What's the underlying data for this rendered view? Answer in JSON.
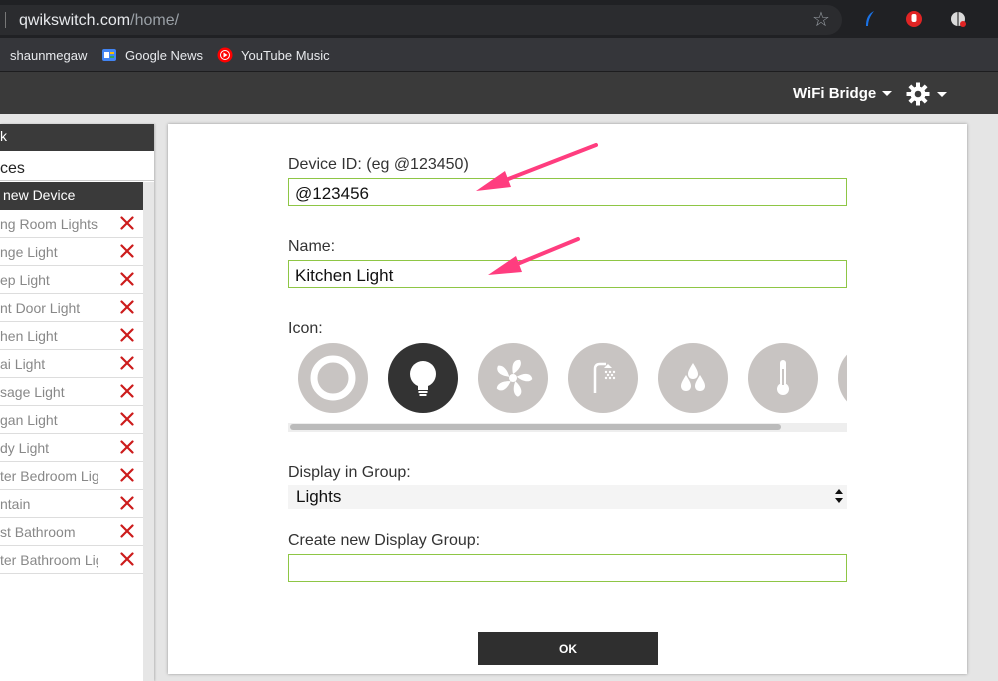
{
  "browser": {
    "url_host": "qwikswitch.com",
    "url_path": "/home/",
    "bookmarks": [
      {
        "label": "shaunmegaw"
      },
      {
        "label": "Google News"
      },
      {
        "label": "YouTube Music"
      }
    ]
  },
  "header": {
    "bridge_label": "WiFi Bridge"
  },
  "sidebar": {
    "top_label": "k",
    "tab_label": "ces",
    "new_device_label": "new Device",
    "items": [
      {
        "label": "ng Room Lights"
      },
      {
        "label": "nge Light"
      },
      {
        "label": "ep Light"
      },
      {
        "label": "nt Door Light"
      },
      {
        "label": "hen Light"
      },
      {
        "label": "ai Light"
      },
      {
        "label": "sage Light"
      },
      {
        "label": "gan Light"
      },
      {
        "label": "dy Light"
      },
      {
        "label": "ter Bedroom Ligl"
      },
      {
        "label": "ntain"
      },
      {
        "label": "st Bathroom"
      },
      {
        "label": "ter Bathroom Lig"
      }
    ]
  },
  "form": {
    "device_id_label": "Device ID: (eg @123450)",
    "device_id_value": "@123456",
    "name_label": "Name:",
    "name_value": "Kitchen Light",
    "icon_label": "Icon:",
    "icons": [
      "ring-icon",
      "lightbulb-icon",
      "fan-icon",
      "shower-icon",
      "water-drops-icon",
      "thermometer-icon",
      "partial-icon"
    ],
    "selected_icon": "lightbulb-icon",
    "group_label": "Display in Group:",
    "group_value": "Lights",
    "new_group_label": "Create new Display Group:",
    "new_group_value": "",
    "ok_label": "OK"
  },
  "colors": {
    "accent_border": "#8ec645",
    "arrow": "#ff3d7f",
    "delete": "#cc1b1b",
    "dark": "#3a3a3a"
  }
}
